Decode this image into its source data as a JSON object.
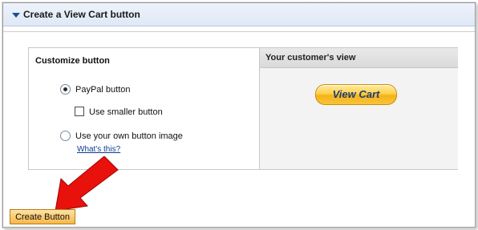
{
  "section": {
    "title": "Create a View Cart button"
  },
  "customize": {
    "heading": "Customize button",
    "paypal_option_label": "PayPal button",
    "paypal_option_selected": true,
    "smaller_label": "Use smaller button",
    "smaller_checked": false,
    "own_image_label": "Use your own button image",
    "own_image_selected": false,
    "help_link": "What's this?"
  },
  "preview": {
    "heading": "Your customer's view",
    "button_label": "View Cart"
  },
  "actions": {
    "create_label": "Create Button"
  },
  "colors": {
    "arrow": "#e8110c",
    "header_triangle": "#1d4f99",
    "link": "#0b3d91"
  },
  "icons": {
    "collapse": "triangle-down-icon",
    "annotation": "red-arrow-icon"
  }
}
